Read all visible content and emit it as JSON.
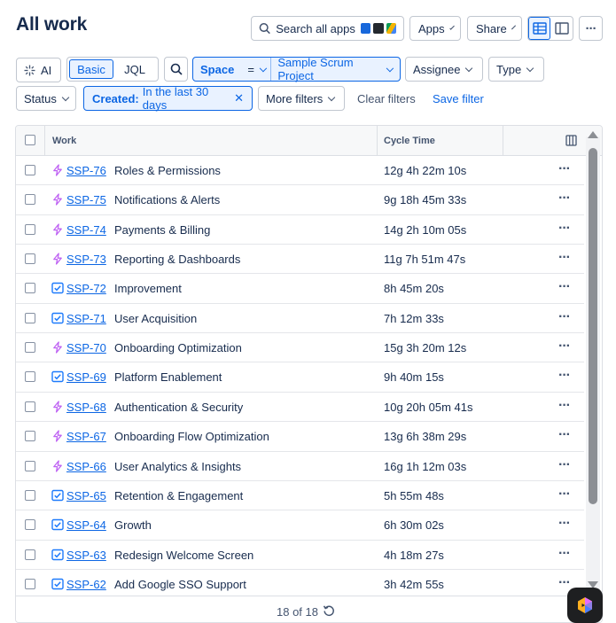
{
  "page": {
    "title": "All work"
  },
  "topbar": {
    "search_label": "Search all apps",
    "apps_label": "Apps",
    "share_label": "Share"
  },
  "filters": {
    "ai_label": "AI",
    "basic_label": "Basic",
    "jql_label": "JQL",
    "space": {
      "label": "Space",
      "operator": "=",
      "value": "Sample Scrum Project"
    },
    "assignee_label": "Assignee",
    "type_label": "Type",
    "status_label": "Status",
    "created": {
      "label": "Created:",
      "value": "In the last 30 days"
    },
    "more_filters_label": "More filters",
    "clear_label": "Clear filters",
    "save_label": "Save filter"
  },
  "table": {
    "columns": [
      "Work",
      "Cycle Time"
    ],
    "rows": [
      {
        "key": "SSP-76",
        "summary": "Roles & Permissions",
        "cycle": "12g 4h 22m 10s",
        "type": "epic"
      },
      {
        "key": "SSP-75",
        "summary": "Notifications & Alerts",
        "cycle": "9g 18h 45m 33s",
        "type": "epic"
      },
      {
        "key": "SSP-74",
        "summary": "Payments & Billing",
        "cycle": "14g 2h 10m 05s",
        "type": "epic"
      },
      {
        "key": "SSP-73",
        "summary": "Reporting & Dashboards",
        "cycle": "11g 7h 51m 47s",
        "type": "epic"
      },
      {
        "key": "SSP-72",
        "summary": "Improvement",
        "cycle": "8h 45m 20s",
        "type": "task"
      },
      {
        "key": "SSP-71",
        "summary": "User Acquisition",
        "cycle": "7h 12m 33s",
        "type": "task"
      },
      {
        "key": "SSP-70",
        "summary": "Onboarding Optimization",
        "cycle": "15g 3h 20m 12s",
        "type": "epic"
      },
      {
        "key": "SSP-69",
        "summary": "Platform Enablement",
        "cycle": "9h 40m 15s",
        "type": "task"
      },
      {
        "key": "SSP-68",
        "summary": "Authentication & Security",
        "cycle": "10g 20h 05m 41s",
        "type": "epic"
      },
      {
        "key": "SSP-67",
        "summary": "Onboarding Flow Optimization",
        "cycle": "13g 6h 38m 29s",
        "type": "epic"
      },
      {
        "key": "SSP-66",
        "summary": "User Analytics & Insights",
        "cycle": "16g 1h 12m 03s",
        "type": "epic"
      },
      {
        "key": "SSP-65",
        "summary": "Retention & Engagement",
        "cycle": "5h 55m 48s",
        "type": "task"
      },
      {
        "key": "SSP-64",
        "summary": "Growth",
        "cycle": "6h 30m 02s",
        "type": "task"
      },
      {
        "key": "SSP-63",
        "summary": "Redesign Welcome Screen",
        "cycle": "4h 18m 27s",
        "type": "task"
      },
      {
        "key": "SSP-62",
        "summary": "Add Google SSO Support",
        "cycle": "3h 42m 55s",
        "type": "task"
      }
    ],
    "footer_count": "18 of 18"
  },
  "colors": {
    "accent": "#0c66e4",
    "epic_icon": "#bf63f3",
    "task_icon": "#1d7afc"
  },
  "icons": {
    "epic": "lightning-icon",
    "task": "checkbox-task-icon",
    "search": "search-icon",
    "more": "more-dots-icon",
    "refresh": "refresh-icon",
    "columns": "columns-icon"
  }
}
